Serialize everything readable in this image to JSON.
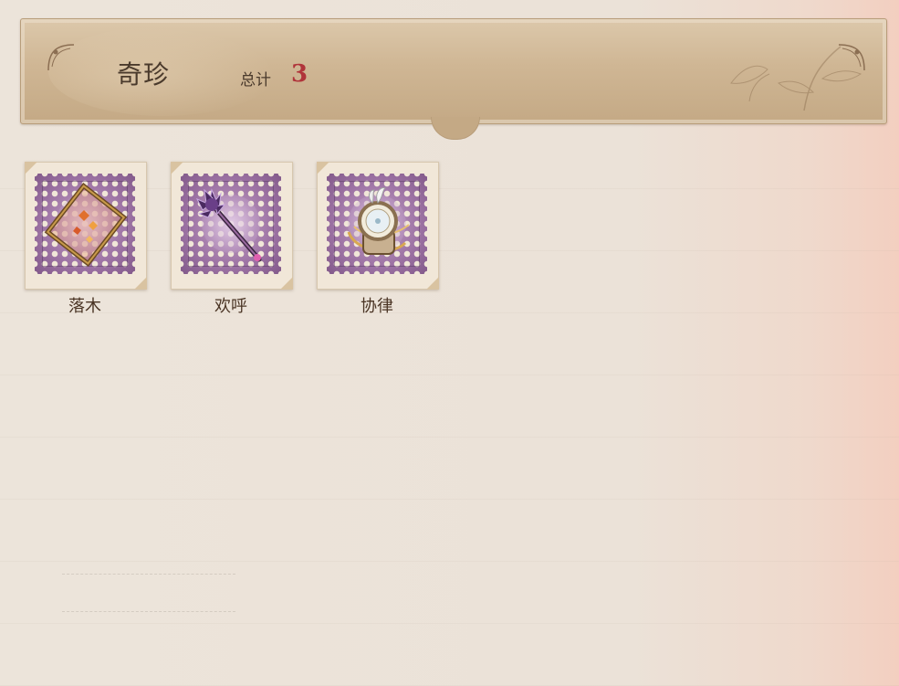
{
  "header": {
    "title": "奇珍",
    "total_label": "总计",
    "total_count": "3"
  },
  "items": [
    {
      "label": "落木",
      "icon": "falling-leaves-frame-icon"
    },
    {
      "label": "欢呼",
      "icon": "cheering-wand-icon"
    },
    {
      "label": "协律",
      "icon": "harmony-pocket-watch-icon"
    }
  ],
  "colors": {
    "header_bg": "#cfb694",
    "stamp_purple": "#9d73a4",
    "count_red": "#b0343a",
    "text_brown": "#4a3a2c"
  }
}
